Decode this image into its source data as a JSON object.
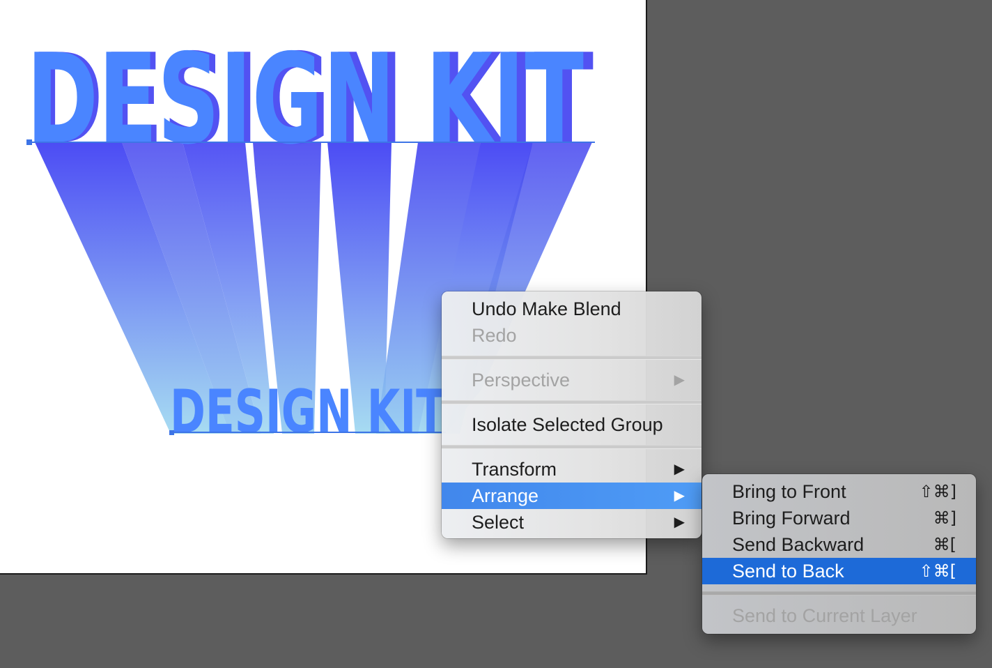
{
  "artwork": {
    "main_text": "DESIGN KIT",
    "small_text": "DESIGN KIT"
  },
  "context_menu": {
    "undo": "Undo Make Blend",
    "redo": "Redo",
    "perspective": "Perspective",
    "isolate": "Isolate Selected Group",
    "transform": "Transform",
    "arrange": "Arrange",
    "select": "Select",
    "submenu_arrow": "▶"
  },
  "arrange_submenu": {
    "items": [
      {
        "label": "Bring to Front",
        "shortcut": "⇧⌘]"
      },
      {
        "label": "Bring Forward",
        "shortcut": "⌘]"
      },
      {
        "label": "Send Backward",
        "shortcut": "⌘["
      },
      {
        "label": "Send to Back",
        "shortcut": "⇧⌘["
      }
    ],
    "send_to_layer": "Send to Current Layer"
  },
  "colors": {
    "pasteboard": "#5d5d5d",
    "text_blue": "#4a85ff",
    "blend_top": "#4c4cf4",
    "blend_bottom": "#a7dcf2",
    "menu_highlight": "#4f9cf6",
    "submenu_highlight": "#1d6ad8"
  }
}
